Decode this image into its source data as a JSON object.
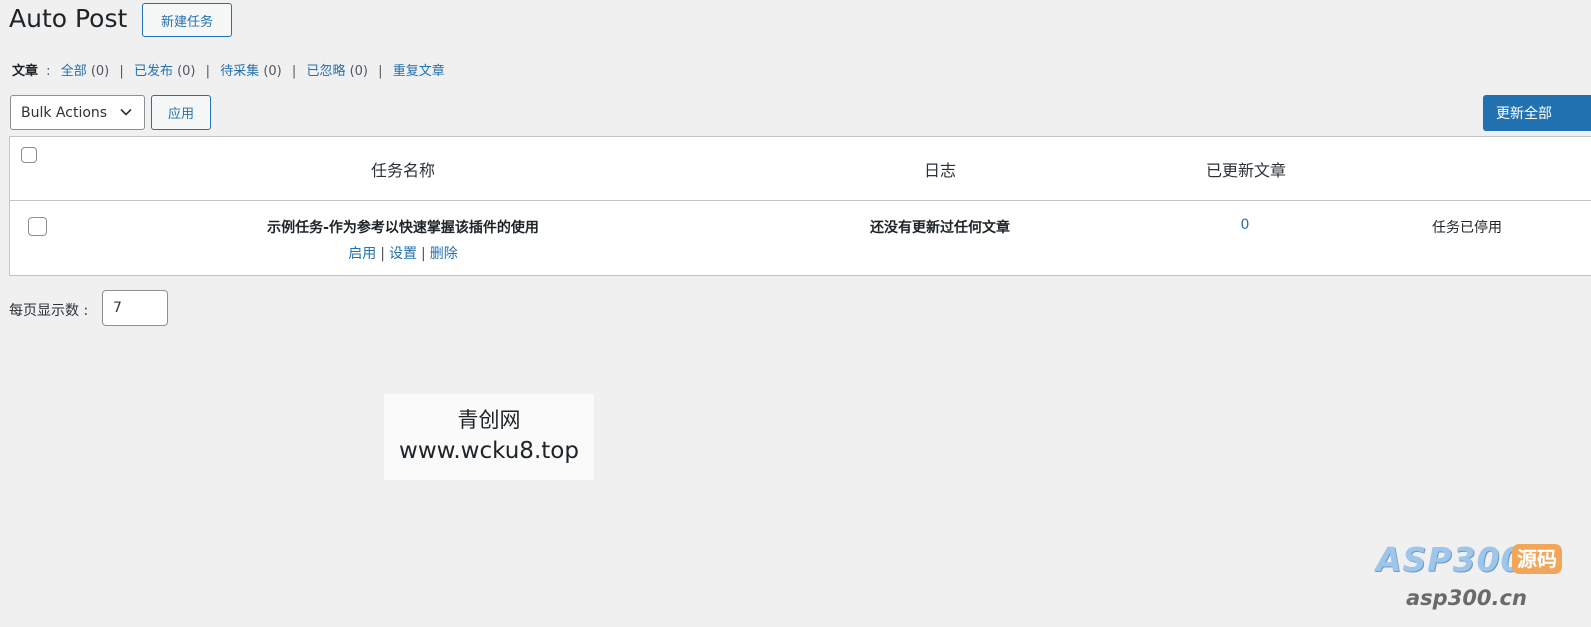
{
  "header": {
    "title": "Auto Post",
    "new_task_label": "新建任务"
  },
  "subsubsub": {
    "label": "文章",
    "colon": ":",
    "items": [
      {
        "label": "全部",
        "count": "(0)"
      },
      {
        "label": "已发布",
        "count": "(0)"
      },
      {
        "label": "待采集",
        "count": "(0)"
      },
      {
        "label": "已忽略",
        "count": "(0)"
      },
      {
        "label": "重复文章",
        "count": ""
      }
    ],
    "separator": "|"
  },
  "toolbar": {
    "bulk_actions_selected": "Bulk Actions",
    "apply_label": "应用",
    "update_all_label": "更新全部"
  },
  "table": {
    "columns": [
      "任务名称",
      "日志",
      "已更新文章"
    ],
    "rows": [
      {
        "name": "示例任务-作为参考以快速掌握该插件的使用",
        "actions": [
          "启用",
          "设置",
          "删除"
        ],
        "log": "还没有更新过任何文章",
        "updated_count": "0",
        "status": "任务已停用"
      }
    ]
  },
  "per_page": {
    "label": "每页显示数 :",
    "value": "7"
  },
  "watermark": {
    "line1": "青创网",
    "line2": "www.wcku8.top"
  },
  "logo": {
    "brand": "ASP300",
    "tag": "源码",
    "domain": "asp300.cn"
  },
  "colors": {
    "background": "#f0f0f1",
    "accent": "#2271b1",
    "primary_button": "#2271b1"
  }
}
